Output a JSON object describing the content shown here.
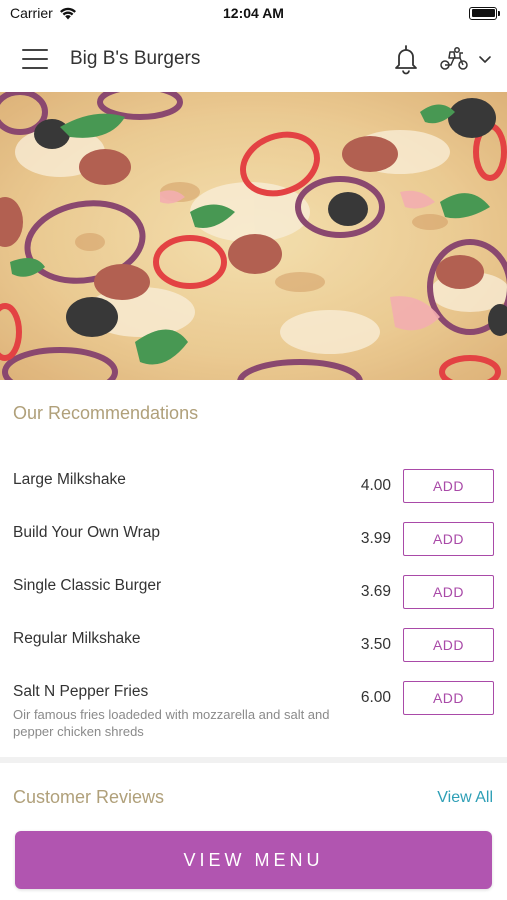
{
  "status": {
    "carrier": "Carrier",
    "time": "12:04 AM"
  },
  "header": {
    "title": "Big B's Burgers",
    "icons": [
      "menu-icon",
      "bell-icon",
      "scooter-icon",
      "chevron-down-icon"
    ]
  },
  "recommendations": {
    "title": "Our Recommendations",
    "add_label": "ADD",
    "items": [
      {
        "name": "Large Milkshake",
        "price": "4.00",
        "description": ""
      },
      {
        "name": "Build Your Own Wrap",
        "price": "3.99",
        "description": ""
      },
      {
        "name": "Single Classic Burger",
        "price": "3.69",
        "description": ""
      },
      {
        "name": "Regular Milkshake",
        "price": "3.50",
        "description": ""
      },
      {
        "name": "Salt N Pepper Fries",
        "price": "6.00",
        "description": "Oir famous fries loadeded with mozzarella and salt and pepper chicken shreds"
      }
    ]
  },
  "reviews": {
    "title": "Customer Reviews",
    "view_all": "View All"
  },
  "footer": {
    "button": "VIEW MENU"
  },
  "colors": {
    "accent": "#b155b0",
    "section_title": "#b0a07a",
    "link": "#2e9fb6"
  }
}
